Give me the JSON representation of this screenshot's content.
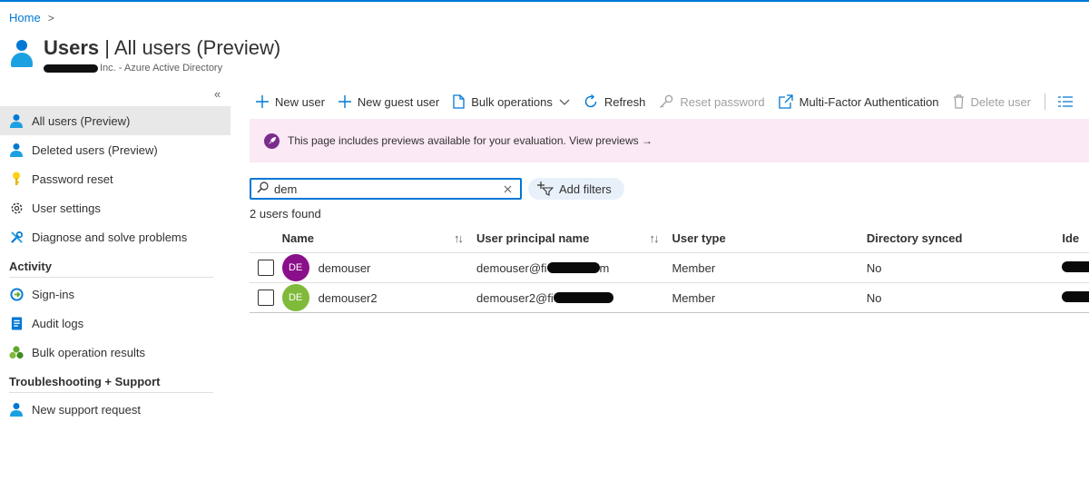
{
  "breadcrumb": {
    "home": "Home",
    "chevron": ">"
  },
  "header": {
    "title_bold": "Users",
    "title_rest": " | All users (Preview)",
    "subtitle": "Inc. - Azure Active Directory"
  },
  "sidebar": {
    "collapse": "«",
    "items": [
      {
        "label": "All users (Preview)",
        "icon": "user-icon",
        "active": true
      },
      {
        "label": "Deleted users (Preview)",
        "icon": "user-icon"
      },
      {
        "label": "Password reset",
        "icon": "key-icon"
      },
      {
        "label": "User settings",
        "icon": "gear-icon"
      },
      {
        "label": "Diagnose and solve problems",
        "icon": "wrench-icon"
      }
    ],
    "activity_head": "Activity",
    "activity": [
      {
        "label": "Sign-ins",
        "icon": "signin-icon"
      },
      {
        "label": "Audit logs",
        "icon": "audit-log-icon"
      },
      {
        "label": "Bulk operation results",
        "icon": "bulk-results-icon"
      }
    ],
    "support_head": "Troubleshooting + Support",
    "support": [
      {
        "label": "New support request",
        "icon": "support-user-icon"
      }
    ]
  },
  "toolbar": {
    "new_user": "New user",
    "new_guest_user": "New guest user",
    "bulk_operations": "Bulk operations",
    "refresh": "Refresh",
    "reset_password": "Reset password",
    "mfa": "Multi-Factor Authentication",
    "delete_user": "Delete user"
  },
  "banner": {
    "text": "This page includes previews available for your evaluation. View previews →"
  },
  "search": {
    "value": "dem"
  },
  "filters": {
    "add_filters": "Add filters"
  },
  "results": {
    "count_text": "2 users found"
  },
  "table": {
    "columns": {
      "name": "Name",
      "upn": "User principal name",
      "type": "User type",
      "synced": "Directory synced",
      "identity": "Ide"
    },
    "sort_glyph": "↑↓",
    "rows": [
      {
        "initials": "DE",
        "avatar_color": "#8a0f8a",
        "name": "demouser",
        "upn_prefix": "demouser@fi",
        "upn_suffix": "m",
        "type": "Member",
        "synced": "No"
      },
      {
        "initials": "DE",
        "avatar_color": "#7fba3a",
        "name": "demouser2",
        "upn_prefix": "demouser2@fi",
        "upn_suffix": "",
        "type": "Member",
        "synced": "No"
      }
    ]
  },
  "colors": {
    "accent": "#0078d4",
    "banner_bg": "#fbe9f6",
    "active_nav": "#e8e8e8"
  }
}
